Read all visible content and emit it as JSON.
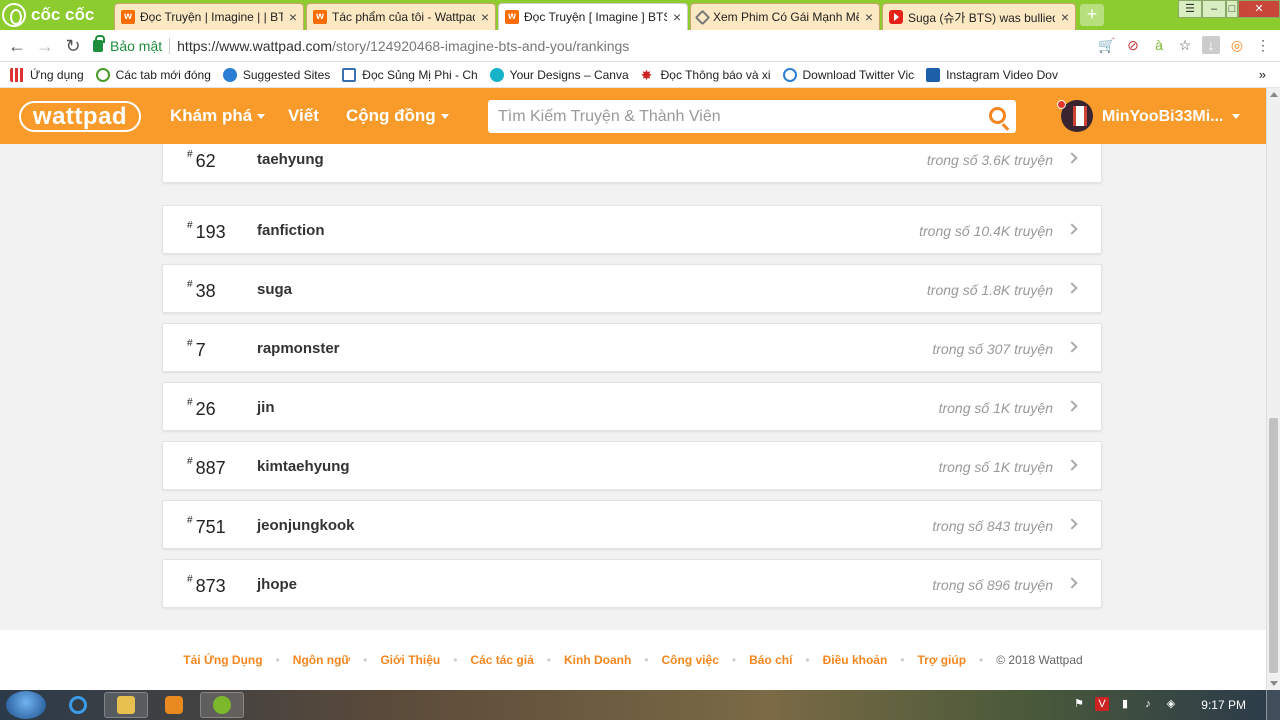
{
  "browser": {
    "brand": "cốc cốc",
    "tabs": [
      {
        "title": "Đọc Truyện | Imagine | | BTS",
        "icon": "wattpad-icon"
      },
      {
        "title": "Tác phẩm của tôi - Wattpad",
        "icon": "wattpad-icon"
      },
      {
        "title": "Đọc Truyện [ Imagine ] BTS",
        "icon": "wattpad-icon",
        "active": true
      },
      {
        "title": "Xem Phim Có Gái Mạnh Mẽ",
        "icon": "movie-icon"
      },
      {
        "title": "Suga (슈가 BTS) was bullied",
        "icon": "youtube-icon"
      }
    ],
    "secure_label": "Bảo mật",
    "url_host": "https://www.wattpad.com",
    "url_path": "/story/124920468-imagine-bts-and-you/rankings",
    "bookmarks": [
      {
        "label": "Ứng dụng",
        "icon": "apps-icon"
      },
      {
        "label": "Các tab mới đóng",
        "icon": "history-icon"
      },
      {
        "label": "Suggested Sites",
        "icon": "ie-icon"
      },
      {
        "label": "Đọc Sủng Mị Phi - Ch",
        "icon": "book-icon"
      },
      {
        "label": "Your Designs – Canva",
        "icon": "canva-icon"
      },
      {
        "label": "Đọc Thông báo và xi",
        "icon": "leaf-icon"
      },
      {
        "label": "Download Twitter Vic",
        "icon": "twitter-icon"
      },
      {
        "label": "Instagram Video Dov",
        "icon": "instagram-icon"
      }
    ],
    "bookmarks_more": "»"
  },
  "wattpad": {
    "logo": "wattpad",
    "nav": {
      "explore": "Khám phá",
      "write": "Viết",
      "community": "Cộng đồng"
    },
    "search_placeholder": "Tìm Kiếm Truyện & Thành Viên",
    "username": "MinYooBi33Mi..."
  },
  "rankings": [
    {
      "rank": "62",
      "tag": "taehyung",
      "count": "trong số 3.6K truyện"
    },
    {
      "rank": "193",
      "tag": "fanfiction",
      "count": "trong số 10.4K truyện"
    },
    {
      "rank": "38",
      "tag": "suga",
      "count": "trong số 1.8K truyện"
    },
    {
      "rank": "7",
      "tag": "rapmonster",
      "count": "trong số 307 truyện"
    },
    {
      "rank": "26",
      "tag": "jin",
      "count": "trong số 1K truyện"
    },
    {
      "rank": "887",
      "tag": "kimtaehyung",
      "count": "trong số 1K truyện"
    },
    {
      "rank": "751",
      "tag": "jeonjungkook",
      "count": "trong số 843 truyện"
    },
    {
      "rank": "873",
      "tag": "jhope",
      "count": "trong số 896 truyện"
    }
  ],
  "footer": {
    "links": [
      "Tải Ứng Dụng",
      "Ngôn ngữ",
      "Giới Thiệu",
      "Các tác giả",
      "Kinh Doanh",
      "Công việc",
      "Báo chí",
      "Điều khoản",
      "Trợ giúp"
    ],
    "copyright": "© 2018 Wattpad"
  },
  "taskbar": {
    "clock": "9:17 PM"
  },
  "colors": {
    "wattpad_orange": "#f89b2b",
    "browser_green": "#8ccc2f",
    "link_orange": "#f5861f"
  }
}
